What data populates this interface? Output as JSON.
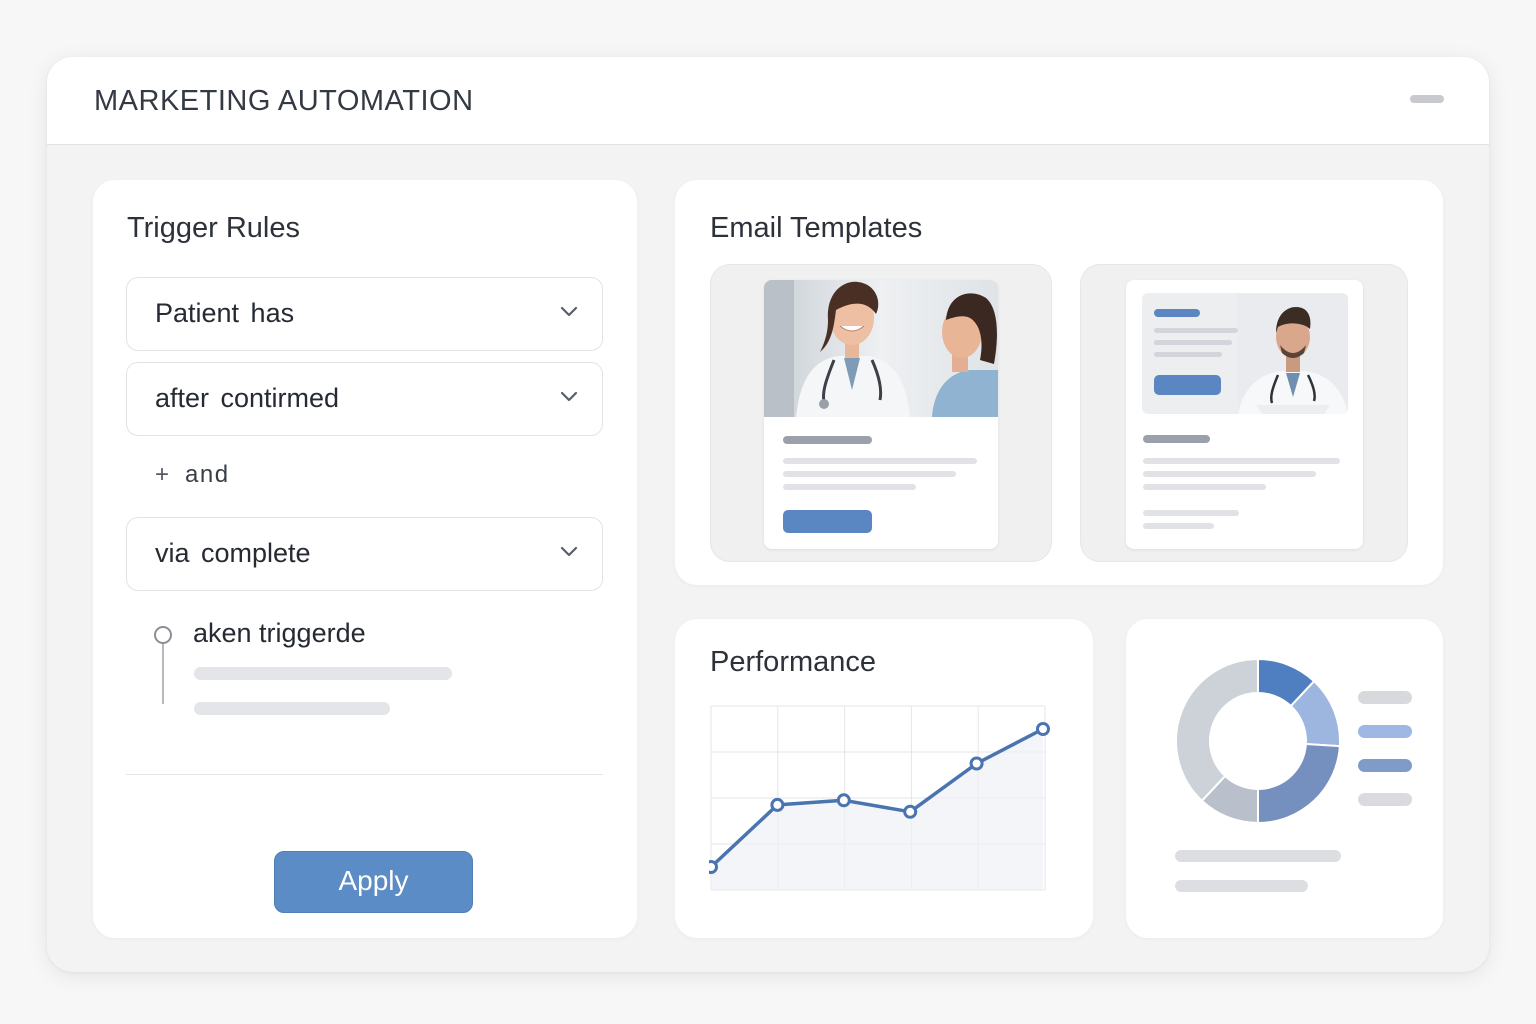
{
  "window": {
    "title": "MARKETING AUTOMATION"
  },
  "trigger_rules": {
    "title": "Trigger Rules",
    "conditions": [
      {
        "label": "Patient has"
      },
      {
        "label": "after contirmed"
      }
    ],
    "connector": "and",
    "condition_after": {
      "label": "via complete"
    },
    "timeline_label": "aken triggerde",
    "apply_label": "Apply"
  },
  "email_templates": {
    "title": "Email Templates"
  },
  "performance": {
    "title": "Performance",
    "chart_data": {
      "type": "line",
      "x": [
        0,
        1,
        2,
        3,
        4,
        5
      ],
      "series": [
        {
          "values": [
            10,
            37,
            39,
            34,
            55,
            70
          ]
        }
      ],
      "ylim": [
        0,
        80
      ],
      "grid": true,
      "line_color": "#4a74b0"
    }
  },
  "breakdown": {
    "chart_data": {
      "type": "pie",
      "donut": true,
      "values": [
        12,
        14,
        24,
        12,
        38
      ],
      "colors": [
        "#4f7fc0",
        "#9cb6e0",
        "#7590be",
        "#b9c0cb",
        "#cdd1d8"
      ],
      "legend_colors": [
        "#d7d9dd",
        "#9eb7e3",
        "#7f9cc9",
        "#d9dbdf"
      ]
    }
  },
  "colors": {
    "accent": "#5b8cc6",
    "line": "#4a74b0"
  }
}
